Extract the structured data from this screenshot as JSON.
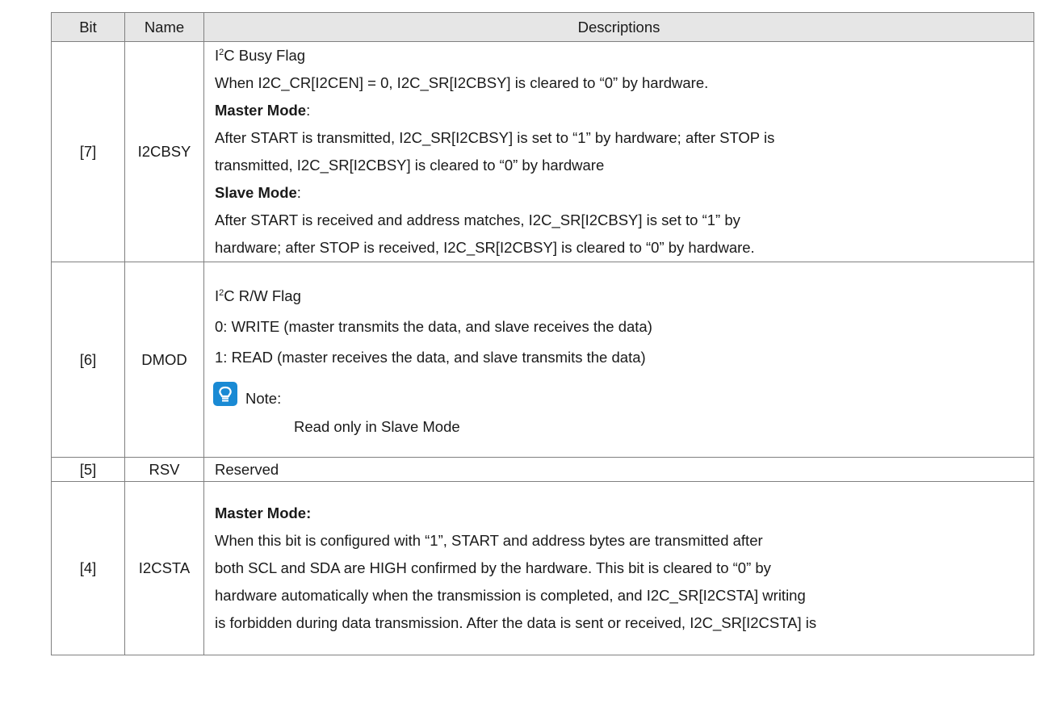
{
  "header": {
    "bit": "Bit",
    "name": "Name",
    "descriptions": "Descriptions"
  },
  "rows": [
    {
      "bit": "[7]",
      "name": "I2CBSY",
      "title_prefix": "I",
      "title_sup": "2",
      "title_suffix": "C Busy Flag",
      "lines": [
        "When I2C_CR[I2CEN] = 0, I2C_SR[I2CBSY] is cleared to “0” by hardware.",
        "Master Mode",
        "After START is transmitted, I2C_SR[I2CBSY] is set to “1” by hardware; after STOP is",
        "transmitted, I2C_SR[I2CBSY] is cleared to “0” by hardware",
        "Slave Mode",
        "After START is received and address matches, I2C_SR[I2CBSY] is set to “1” by",
        "hardware; after STOP is received, I2C_SR[I2CBSY] is cleared to “0” by hardware."
      ],
      "colon": ":"
    },
    {
      "bit": "[6]",
      "name": "DMOD",
      "title_prefix": "I",
      "title_sup": "2",
      "title_suffix": "C R/W Flag",
      "lines": [
        "0: WRITE (master transmits the data, and slave receives the data)",
        "1: READ (master receives the data, and slave transmits the data)"
      ],
      "note_label": "Note:",
      "note_text": "Read only in Slave Mode",
      "note_icon": "lightbulb-icon",
      "note_color": "#1a8ad4"
    },
    {
      "bit": "[5]",
      "name": "RSV",
      "description": "Reserved"
    },
    {
      "bit": "[4]",
      "name": "I2CSTA",
      "lines": [
        "Master Mode:",
        "When this bit is configured with “1”, START and address bytes are transmitted after",
        "both SCL and SDA are HIGH confirmed by the hardware. This bit is cleared to “0” by",
        "hardware automatically when the transmission is completed, and I2C_SR[I2CSTA] writing",
        "is forbidden during data transmission. After the data is sent or received, I2C_SR[I2CSTA] is"
      ]
    }
  ]
}
